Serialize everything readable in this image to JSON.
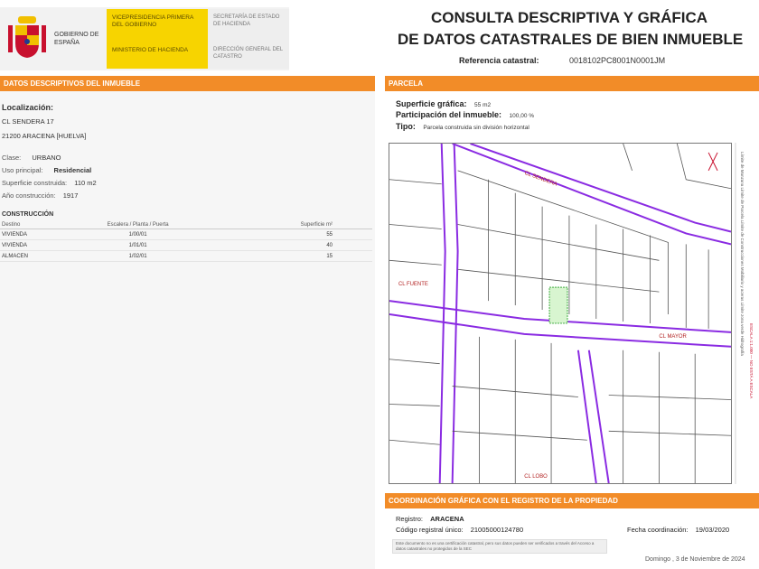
{
  "header": {
    "gov_name": "GOBIERNO DE ESPAÑA",
    "ministry_top": "VICEPRESIDENCIA PRIMERA DEL GOBIERNO",
    "ministry_bottom": "MINISTERIO DE HACIENDA",
    "agency_top": "SECRETARÍA DE ESTADO DE HACIENDA",
    "agency_bottom": "DIRECCIÓN GENERAL DEL CATASTRO",
    "title_line1": "CONSULTA DESCRIPTIVA Y GRÁFICA",
    "title_line2": "DE DATOS CATASTRALES DE BIEN INMUEBLE",
    "ref_label": "Referencia catastral:",
    "ref_value": "0018102PC8001N0001JM",
    "colors": {
      "shield_red": "#c8102e",
      "shield_yellow": "#f1bf00",
      "ministry_yellow": "#f7d400",
      "section_orange": "#f28c28"
    }
  },
  "left": {
    "section_title": "DATOS DESCRIPTIVOS DEL INMUEBLE",
    "localizacion_label": "Localización:",
    "address_line1": "CL SENDERA 17",
    "address_line2": "21200 ARACENA [HUELVA]",
    "clase_label": "Clase:",
    "clase_value": "URBANO",
    "uso_label": "Uso principal:",
    "uso_value": "Residencial",
    "superficie_label": "Superficie construida:",
    "superficie_value": "110 m2",
    "anio_label": "Año construcción:",
    "anio_value": "1917",
    "construccion_title": "CONSTRUCCIÓN",
    "table_headers": [
      "Destino",
      "Escalera / Planta / Puerta",
      "Superficie m²"
    ],
    "table_rows": [
      [
        "VIVIENDA",
        "1/00/01",
        "55"
      ],
      [
        "VIVIENDA",
        "1/01/01",
        "40"
      ],
      [
        "ALMACEN",
        "1/02/01",
        "15"
      ]
    ]
  },
  "right": {
    "section_title": "PARCELA",
    "superficie_grafica_label": "Superficie gráfica:",
    "superficie_grafica_value": "55 m2",
    "participacion_label": "Participación del inmueble:",
    "participacion_value": "100,00 %",
    "tipo_label": "Tipo:",
    "tipo_value": "Parcela construida sin división horizontal",
    "map_street_1": "CL SENDERA",
    "map_street_2": "CL MAYOR",
    "map_street_3": "CL FUENTE",
    "map_street_4": "CL LOBO",
    "legend_text": "Límite de Manzana   Límite de Parcela   Límite de Construcciones   Mobiliario y aceras   Límite zona verde   Hidrografía",
    "legend_scale_text": "ESCALA 1:1.000 — NO ESTÁ A ESCALA"
  },
  "coord": {
    "section_title": "COORDINACIÓN GRÁFICA CON EL REGISTRO DE LA PROPIEDAD",
    "registro_label": "Registro:",
    "registro_value": "ARACENA",
    "codigo_label": "Código registral único:",
    "codigo_value": "21005000124780",
    "fecha_label": "Fecha coordinación:",
    "fecha_value": "19/03/2020",
    "note": "Este documento no es una certificación catastral, pero sus datos pueden ser verificados a través del Acceso a datos catastrales no protegidos de la SEC",
    "footer_date": "Domingo , 3 de Noviembre de 2024"
  }
}
